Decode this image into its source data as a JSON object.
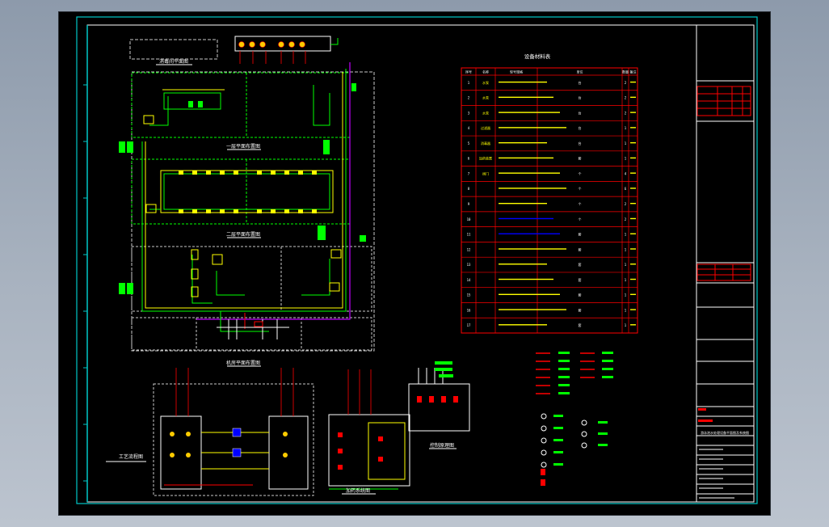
{
  "colors": {
    "background": "#000000",
    "frame": "#00c8c8",
    "border": "#ffffff",
    "pipe_green": "#00ff00",
    "pipe_yellow": "#ffff00",
    "pipe_red": "#ff0000",
    "pipe_magenta": "#c000ff",
    "pipe_blue": "#0000ff",
    "dashed": "#c8c8c8"
  },
  "drawing": {
    "table_title": "设备材料表",
    "plan_labels": {
      "upper_box": "消毒间平面图",
      "floor_1": "一层平面布置图",
      "floor_2": "二层平面布置图",
      "plant_room": "机房平面布置图",
      "sys_left": "工艺流程图",
      "sys_mid": "加药系统图",
      "sys_right": "控制原理图"
    }
  },
  "equipment_table": {
    "header": [
      "序号",
      "名称",
      "型号规格",
      "单位",
      "数量",
      "备注"
    ],
    "rows": [
      [
        "1",
        "水泵",
        "",
        "台",
        "2",
        ""
      ],
      [
        "2",
        "水泵",
        "",
        "台",
        "2",
        ""
      ],
      [
        "3",
        "水泵",
        "",
        "台",
        "2",
        ""
      ],
      [
        "4",
        "过滤器",
        "",
        "台",
        "1",
        ""
      ],
      [
        "5",
        "消毒器",
        "",
        "台",
        "1",
        ""
      ],
      [
        "6",
        "加药装置",
        "",
        "套",
        "1",
        ""
      ],
      [
        "7",
        "阀门",
        "",
        "个",
        "4",
        ""
      ],
      [
        "8",
        "",
        "",
        "个",
        "6",
        ""
      ],
      [
        "9",
        "",
        "",
        "个",
        "2",
        ""
      ],
      [
        "10",
        "",
        "",
        "个",
        "2",
        ""
      ],
      [
        "11",
        "",
        "",
        "套",
        "1",
        ""
      ],
      [
        "12",
        "",
        "",
        "套",
        "1",
        ""
      ],
      [
        "13",
        "",
        "",
        "套",
        "1",
        ""
      ],
      [
        "14",
        "",
        "",
        "套",
        "1",
        ""
      ],
      [
        "15",
        "",
        "",
        "套",
        "1",
        ""
      ],
      [
        "16",
        "",
        "",
        "套",
        "1",
        ""
      ],
      [
        "17",
        "",
        "",
        "套",
        "1",
        ""
      ]
    ]
  },
  "title_block": {
    "drawing_title": "游泳池水处理设备平面图及系统图"
  }
}
